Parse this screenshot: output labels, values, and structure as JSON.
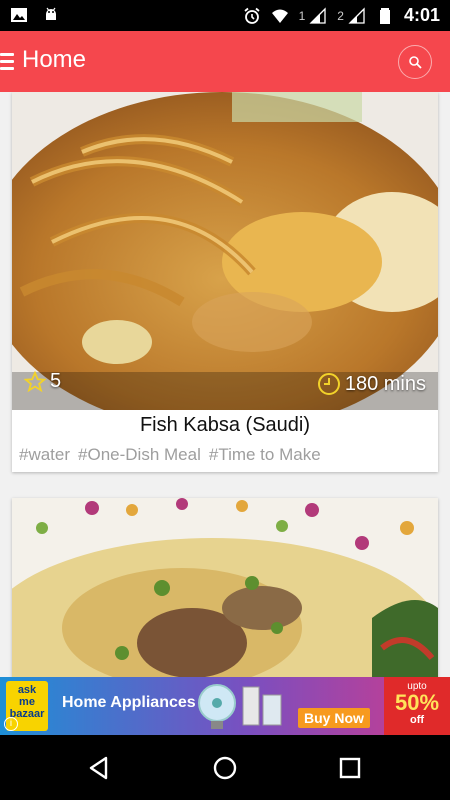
{
  "status_bar": {
    "sim1": "1",
    "sim2": "2",
    "time": "4:01",
    "icons": [
      "image-icon",
      "android-icon",
      "alarm-icon",
      "wifi-icon",
      "signal-icon",
      "signal-icon",
      "battery-icon"
    ]
  },
  "app_bar": {
    "title": "Home",
    "menu_icon": "hamburger-menu-icon",
    "search_icon": "search-icon"
  },
  "recipes": [
    {
      "rating": "5",
      "time": "180 mins",
      "title": "Fish Kabsa (Saudi)",
      "tags": [
        "#water",
        "#One-Dish Meal",
        "#Time to Make"
      ]
    },
    {
      "title": "",
      "tags": []
    }
  ],
  "ad": {
    "brand_line1": "ask",
    "brand_line2": "me",
    "brand_line3": "bazaar",
    "title": "Home Appliances",
    "cta": "Buy Now",
    "upto": "upto",
    "percent": "50%",
    "off": "off",
    "info": "i"
  },
  "colors": {
    "app_bar": "#f5474d",
    "accent_yellow": "#f2d22a"
  }
}
